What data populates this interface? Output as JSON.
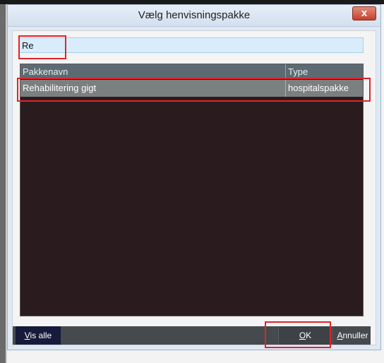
{
  "dialog": {
    "title": "Vælg henvisningspakke",
    "close_label": "x"
  },
  "search": {
    "value": "Re",
    "placeholder": ""
  },
  "table": {
    "columns": [
      "Pakkenavn",
      "Type"
    ],
    "rows": [
      {
        "name": "Rehabilitering gigt",
        "type": "hospitalspakke"
      }
    ]
  },
  "footer": {
    "vis_alle_prefix": "V",
    "vis_alle_rest": "is alle",
    "ok_prefix": "O",
    "ok_rest": "K",
    "annuller_prefix": "A",
    "annuller_rest": "nnuller"
  },
  "colors": {
    "highlight": "#e0242c",
    "list_background": "#2a1c1e",
    "selected_row": "#7b7f80"
  }
}
